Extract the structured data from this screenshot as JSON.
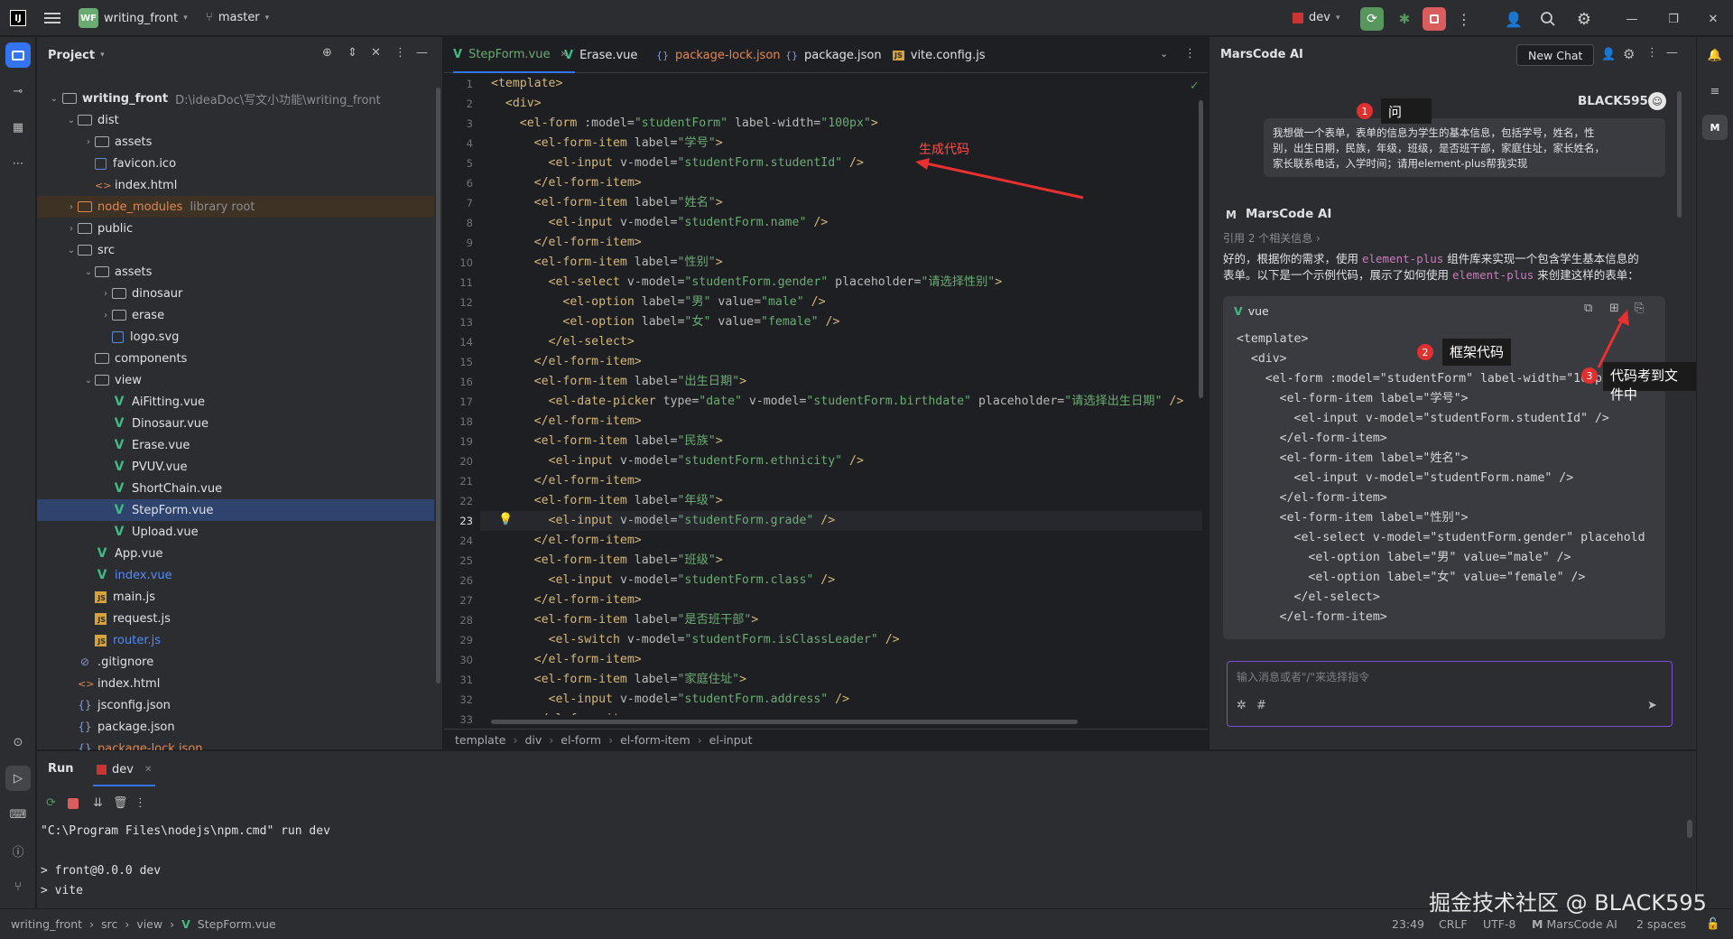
{
  "titlebar": {
    "project_badge": "WF",
    "project_name": "writing_front",
    "branch": "master",
    "run_config": "dev"
  },
  "project_panel": {
    "title": "Project",
    "root_name": "writing_front",
    "root_path": "D:\\ideaDoc\\写文小功能\\writing_front",
    "items": [
      {
        "label": "dist",
        "type": "folder",
        "depth": 1,
        "open": true
      },
      {
        "label": "assets",
        "type": "folder",
        "depth": 2,
        "open": false
      },
      {
        "label": "favicon.ico",
        "type": "img",
        "depth": 2
      },
      {
        "label": "index.html",
        "type": "html",
        "depth": 2
      },
      {
        "label": "node_modules",
        "type": "folder",
        "depth": 1,
        "open": false,
        "extra": "library root",
        "tint": "#e08855"
      },
      {
        "label": "public",
        "type": "folder",
        "depth": 1,
        "open": false
      },
      {
        "label": "src",
        "type": "folder",
        "depth": 1,
        "open": true
      },
      {
        "label": "assets",
        "type": "folder",
        "depth": 2,
        "open": true
      },
      {
        "label": "dinosaur",
        "type": "folder",
        "depth": 3,
        "open": false
      },
      {
        "label": "erase",
        "type": "folder",
        "depth": 3,
        "open": false
      },
      {
        "label": "logo.svg",
        "type": "img",
        "depth": 3
      },
      {
        "label": "components",
        "type": "folder",
        "depth": 2
      },
      {
        "label": "view",
        "type": "folder",
        "depth": 2,
        "open": true
      },
      {
        "label": "AiFitting.vue",
        "type": "vue",
        "depth": 3
      },
      {
        "label": "Dinosaur.vue",
        "type": "vue",
        "depth": 3
      },
      {
        "label": "Erase.vue",
        "type": "vue",
        "depth": 3
      },
      {
        "label": "PVUV.vue",
        "type": "vue",
        "depth": 3
      },
      {
        "label": "ShortChain.vue",
        "type": "vue",
        "depth": 3
      },
      {
        "label": "StepForm.vue",
        "type": "vue",
        "depth": 3,
        "selected": true
      },
      {
        "label": "Upload.vue",
        "type": "vue",
        "depth": 3
      },
      {
        "label": "App.vue",
        "type": "vue",
        "depth": 2
      },
      {
        "label": "index.vue",
        "type": "vue",
        "depth": 2,
        "tint": "#548af7"
      },
      {
        "label": "main.js",
        "type": "js",
        "depth": 2
      },
      {
        "label": "request.js",
        "type": "js",
        "depth": 2
      },
      {
        "label": "router.js",
        "type": "js",
        "depth": 2,
        "tint": "#548af7"
      },
      {
        "label": ".gitignore",
        "type": "ignore",
        "depth": 1
      },
      {
        "label": "index.html",
        "type": "html",
        "depth": 1
      },
      {
        "label": "jsconfig.json",
        "type": "json",
        "depth": 1
      },
      {
        "label": "package.json",
        "type": "json",
        "depth": 1
      },
      {
        "label": "package-lock.json",
        "type": "json",
        "depth": 1,
        "tint": "#e08855"
      }
    ]
  },
  "editor": {
    "tabs": [
      {
        "label": "StepForm.vue",
        "icon": "vue",
        "active": true
      },
      {
        "label": "Erase.vue",
        "icon": "vue"
      },
      {
        "label": "package-lock.json",
        "icon": "json",
        "tint": "#e08855"
      },
      {
        "label": "package.json",
        "icon": "json"
      },
      {
        "label": "vite.config.js",
        "icon": "js"
      }
    ],
    "lines": [
      [
        [
          "tg",
          "<template>"
        ]
      ],
      [
        [
          "pl",
          "  "
        ],
        [
          "tg",
          "<div>"
        ]
      ],
      [
        [
          "pl",
          "    "
        ],
        [
          "tg",
          "<el-form "
        ],
        [
          "at",
          ":model="
        ],
        [
          "st",
          "\"studentForm\" "
        ],
        [
          "at",
          "label-width="
        ],
        [
          "st",
          "\"100px\""
        ],
        [
          "tg",
          ">"
        ]
      ],
      [
        [
          "pl",
          "      "
        ],
        [
          "tg",
          "<el-form-item "
        ],
        [
          "at",
          "label="
        ],
        [
          "st",
          "\"学号\""
        ],
        [
          "tg",
          ">"
        ]
      ],
      [
        [
          "pl",
          "        "
        ],
        [
          "tg",
          "<el-input "
        ],
        [
          "at",
          "v-model="
        ],
        [
          "st",
          "\"studentForm.studentId\" "
        ],
        [
          "tg",
          "/>"
        ]
      ],
      [
        [
          "pl",
          "      "
        ],
        [
          "tg",
          "</el-form-item>"
        ]
      ],
      [
        [
          "pl",
          "      "
        ],
        [
          "tg",
          "<el-form-item "
        ],
        [
          "at",
          "label="
        ],
        [
          "st",
          "\"姓名\""
        ],
        [
          "tg",
          ">"
        ]
      ],
      [
        [
          "pl",
          "        "
        ],
        [
          "tg",
          "<el-input "
        ],
        [
          "at",
          "v-model="
        ],
        [
          "st",
          "\"studentForm.name\" "
        ],
        [
          "tg",
          "/>"
        ]
      ],
      [
        [
          "pl",
          "      "
        ],
        [
          "tg",
          "</el-form-item>"
        ]
      ],
      [
        [
          "pl",
          "      "
        ],
        [
          "tg",
          "<el-form-item "
        ],
        [
          "at",
          "label="
        ],
        [
          "st",
          "\"性别\""
        ],
        [
          "tg",
          ">"
        ]
      ],
      [
        [
          "pl",
          "        "
        ],
        [
          "tg",
          "<el-select "
        ],
        [
          "at",
          "v-model="
        ],
        [
          "st",
          "\"studentForm.gender\" "
        ],
        [
          "at",
          "placeholder="
        ],
        [
          "st",
          "\"请选择性别\""
        ],
        [
          "tg",
          ">"
        ]
      ],
      [
        [
          "pl",
          "          "
        ],
        [
          "tg",
          "<el-option "
        ],
        [
          "at",
          "label="
        ],
        [
          "st",
          "\"男\" "
        ],
        [
          "at",
          "value="
        ],
        [
          "st",
          "\"male\" "
        ],
        [
          "tg",
          "/>"
        ]
      ],
      [
        [
          "pl",
          "          "
        ],
        [
          "tg",
          "<el-option "
        ],
        [
          "at",
          "label="
        ],
        [
          "st",
          "\"女\" "
        ],
        [
          "at",
          "value="
        ],
        [
          "st",
          "\"female\" "
        ],
        [
          "tg",
          "/>"
        ]
      ],
      [
        [
          "pl",
          "        "
        ],
        [
          "tg",
          "</el-select>"
        ]
      ],
      [
        [
          "pl",
          "      "
        ],
        [
          "tg",
          "</el-form-item>"
        ]
      ],
      [
        [
          "pl",
          "      "
        ],
        [
          "tg",
          "<el-form-item "
        ],
        [
          "at",
          "label="
        ],
        [
          "st",
          "\"出生日期\""
        ],
        [
          "tg",
          ">"
        ]
      ],
      [
        [
          "pl",
          "        "
        ],
        [
          "tg",
          "<el-date-picker "
        ],
        [
          "at",
          "type="
        ],
        [
          "st",
          "\"date\" "
        ],
        [
          "at",
          "v-model="
        ],
        [
          "st",
          "\"studentForm.birthdate\" "
        ],
        [
          "at",
          "placeholder="
        ],
        [
          "st",
          "\"请选择出生日期\" "
        ],
        [
          "tg",
          "/>"
        ]
      ],
      [
        [
          "pl",
          "      "
        ],
        [
          "tg",
          "</el-form-item>"
        ]
      ],
      [
        [
          "pl",
          "      "
        ],
        [
          "tg",
          "<el-form-item "
        ],
        [
          "at",
          "label="
        ],
        [
          "st",
          "\"民族\""
        ],
        [
          "tg",
          ">"
        ]
      ],
      [
        [
          "pl",
          "        "
        ],
        [
          "tg",
          "<el-input "
        ],
        [
          "at",
          "v-model="
        ],
        [
          "st",
          "\"studentForm.ethnicity\" "
        ],
        [
          "tg",
          "/>"
        ]
      ],
      [
        [
          "pl",
          "      "
        ],
        [
          "tg",
          "</el-form-item>"
        ]
      ],
      [
        [
          "pl",
          "      "
        ],
        [
          "tg",
          "<el-form-item "
        ],
        [
          "at",
          "label="
        ],
        [
          "st",
          "\"年级\""
        ],
        [
          "tg",
          ">"
        ]
      ],
      [
        [
          "pl",
          "        "
        ],
        [
          "tg",
          "<el-input "
        ],
        [
          "at",
          "v-model="
        ],
        [
          "st",
          "\"studentForm.grade\" "
        ],
        [
          "tg",
          "/>"
        ]
      ],
      [
        [
          "pl",
          "      "
        ],
        [
          "tg",
          "</el-form-item>"
        ]
      ],
      [
        [
          "pl",
          "      "
        ],
        [
          "tg",
          "<el-form-item "
        ],
        [
          "at",
          "label="
        ],
        [
          "st",
          "\"班级\""
        ],
        [
          "tg",
          ">"
        ]
      ],
      [
        [
          "pl",
          "        "
        ],
        [
          "tg",
          "<el-input "
        ],
        [
          "at",
          "v-model="
        ],
        [
          "st",
          "\"studentForm.class\" "
        ],
        [
          "tg",
          "/>"
        ]
      ],
      [
        [
          "pl",
          "      "
        ],
        [
          "tg",
          "</el-form-item>"
        ]
      ],
      [
        [
          "pl",
          "      "
        ],
        [
          "tg",
          "<el-form-item "
        ],
        [
          "at",
          "label="
        ],
        [
          "st",
          "\"是否班干部\""
        ],
        [
          "tg",
          ">"
        ]
      ],
      [
        [
          "pl",
          "        "
        ],
        [
          "tg",
          "<el-switch "
        ],
        [
          "at",
          "v-model="
        ],
        [
          "st",
          "\"studentForm.isClassLeader\" "
        ],
        [
          "tg",
          "/>"
        ]
      ],
      [
        [
          "pl",
          "      "
        ],
        [
          "tg",
          "</el-form-item>"
        ]
      ],
      [
        [
          "pl",
          "      "
        ],
        [
          "tg",
          "<el-form-item "
        ],
        [
          "at",
          "label="
        ],
        [
          "st",
          "\"家庭住址\""
        ],
        [
          "tg",
          ">"
        ]
      ],
      [
        [
          "pl",
          "        "
        ],
        [
          "tg",
          "<el-input "
        ],
        [
          "at",
          "v-model="
        ],
        [
          "st",
          "\"studentForm.address\" "
        ],
        [
          "tg",
          "/>"
        ]
      ],
      [
        [
          "pl",
          "      "
        ],
        [
          "tg",
          "</el-form-item>"
        ]
      ]
    ],
    "current_line": 23,
    "breadcrumb": [
      "template",
      "div",
      "el-form",
      "el-form-item",
      "el-input"
    ],
    "annotation": "生成代码"
  },
  "ai_panel": {
    "title": "MarsCode AI",
    "new_chat": "New Chat",
    "username": "BLACK595",
    "user_message": "我想做一个表单，表单的信息为学生的基本信息，包括学号，姓名，性别，出生日期，民族，年级，班级，是否班干部，家庭住址，家长姓名，家长联系电话，入学时间；请用element-plus帮我实现",
    "user_message_lines": [
      "我想做一个表单，表单的信息为学生的基本信息，包括学号，姓名，性",
      "别，出生日期，民族，年级，班级，是否班干部，家庭住址，家长姓名，",
      "家长联系电话，入学时间；请用element-plus帮我实现"
    ],
    "assistant_name": "MarsCode AI",
    "references": "引用 2 个相关信息",
    "reply_line1_a": "好的，根据你的需求，使用 ",
    "reply_line1_code": "element-plus",
    "reply_line1_b": " 组件库来实现一个包含学生基本信息的",
    "reply_line2_a": "表单。以下是一个示例代码，展示了如何使用 ",
    "reply_line2_code": "element-plus",
    "reply_line2_b": " 来创建这样的表单：",
    "code_lang": "vue",
    "code_lines": [
      "<template>",
      "  <div>",
      "    <el-form :model=\"studentForm\" label-width=\"100px",
      "      <el-form-item label=\"学号\">",
      "        <el-input v-model=\"studentForm.studentId\" />",
      "      </el-form-item>",
      "      <el-form-item label=\"姓名\">",
      "        <el-input v-model=\"studentForm.name\" />",
      "      </el-form-item>",
      "      <el-form-item label=\"性别\">",
      "        <el-select v-model=\"studentForm.gender\" placehold",
      "          <el-option label=\"男\" value=\"male\" />",
      "          <el-option label=\"女\" value=\"female\" />",
      "        </el-select>",
      "      </el-form-item>"
    ],
    "input_placeholder": "输入消息或者\"/\"来选择指令",
    "annotations": [
      {
        "num": "1",
        "label": "问"
      },
      {
        "num": "2",
        "label": "框架代码"
      },
      {
        "num": "3",
        "label": "代码考到文件中"
      }
    ]
  },
  "run_panel": {
    "tab_run": "Run",
    "tab_dev": "dev",
    "console": [
      "\"C:\\Program Files\\nodejs\\npm.cmd\" run dev",
      "",
      "> front@0.0.0 dev",
      "> vite"
    ]
  },
  "statusbar": {
    "path": [
      "writing_front",
      "src",
      "view",
      "StepForm.vue"
    ],
    "position": "23:49",
    "line_sep": "CRLF",
    "encoding": "UTF-8",
    "plugin": "MarsCode AI",
    "indent": "2 spaces"
  },
  "watermark": "掘金技术社区 @ BLACK595",
  "colors": {
    "accent": "#3574f0",
    "vue": "#42b883",
    "annotation_red": "#e03030"
  }
}
